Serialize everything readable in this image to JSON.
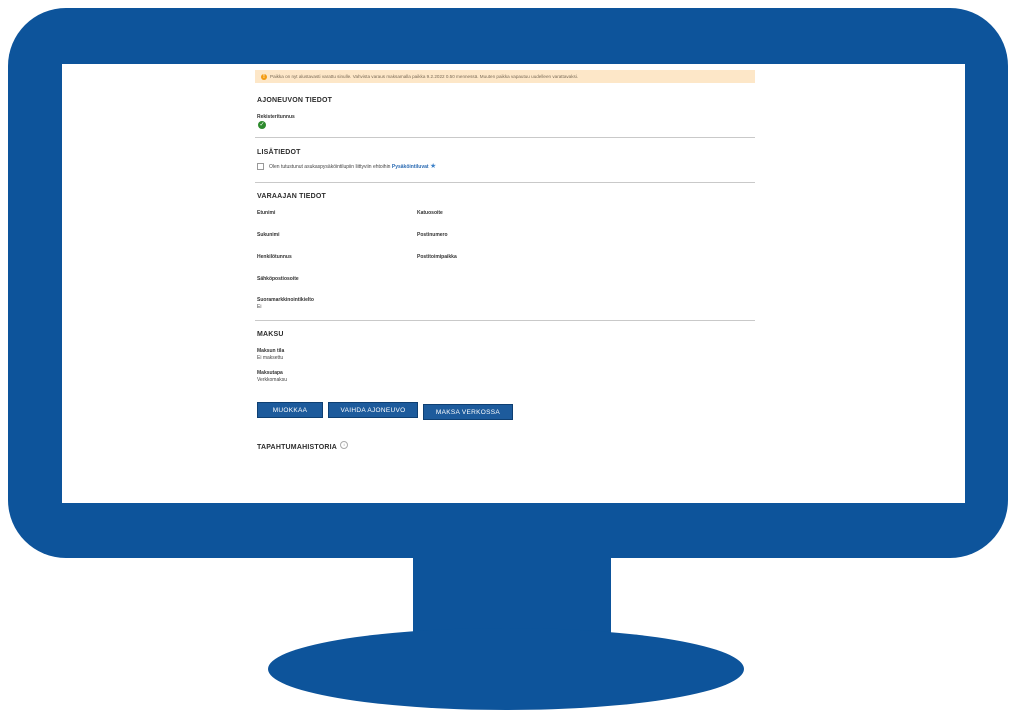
{
  "colors": {
    "monitor": "#0d549b",
    "alert_bg": "#fde7c8",
    "button": "#1d5b9c",
    "check": "#2e8b2e",
    "link": "#2a6ab2"
  },
  "alert": {
    "icon": "warning-icon",
    "text": "Paikka on nyt alustavasti varattu sinulle. Vahvista varaus maksamalla paikka 9.2.2022 0.50 mennessä. Muuten paikka vapautuu uudelleen varattavaksi."
  },
  "vehicle": {
    "title": "AJONEUVON TIEDOT",
    "reg_label": "Rekisteritunnus",
    "reg_icon": "check-circle-icon"
  },
  "extra": {
    "title": "LISÄTIEDOT",
    "terms_text": "Olen tutustunut asukaspysäköintilupiin liittyviin ehtoihin",
    "terms_link": "Pysäköintiluvat"
  },
  "reserver": {
    "title": "VARAAJAN TIEDOT",
    "first_name": "Etunimi",
    "last_name": "Sukunimi",
    "ssn": "Henkilötunnus",
    "email": "Sähköpostiosoite",
    "marketing": "Suoramarkkinointikielto",
    "marketing_value": "Ei",
    "street": "Katuosoite",
    "postal_code": "Postinumero",
    "city": "Postitoimipaikka"
  },
  "payment": {
    "title": "MAKSU",
    "status_label": "Maksun tila",
    "status_value": "Ei maksettu",
    "method_label": "Maksutapa",
    "method_value": "Verkkomaksu"
  },
  "buttons": {
    "edit": "MUOKKAA",
    "change_vehicle": "VAIHDA AJONEUVO",
    "pay_online": "MAKSA VERKOSSA"
  },
  "history": {
    "title": "TAPAHTUMAHISTORIA"
  }
}
